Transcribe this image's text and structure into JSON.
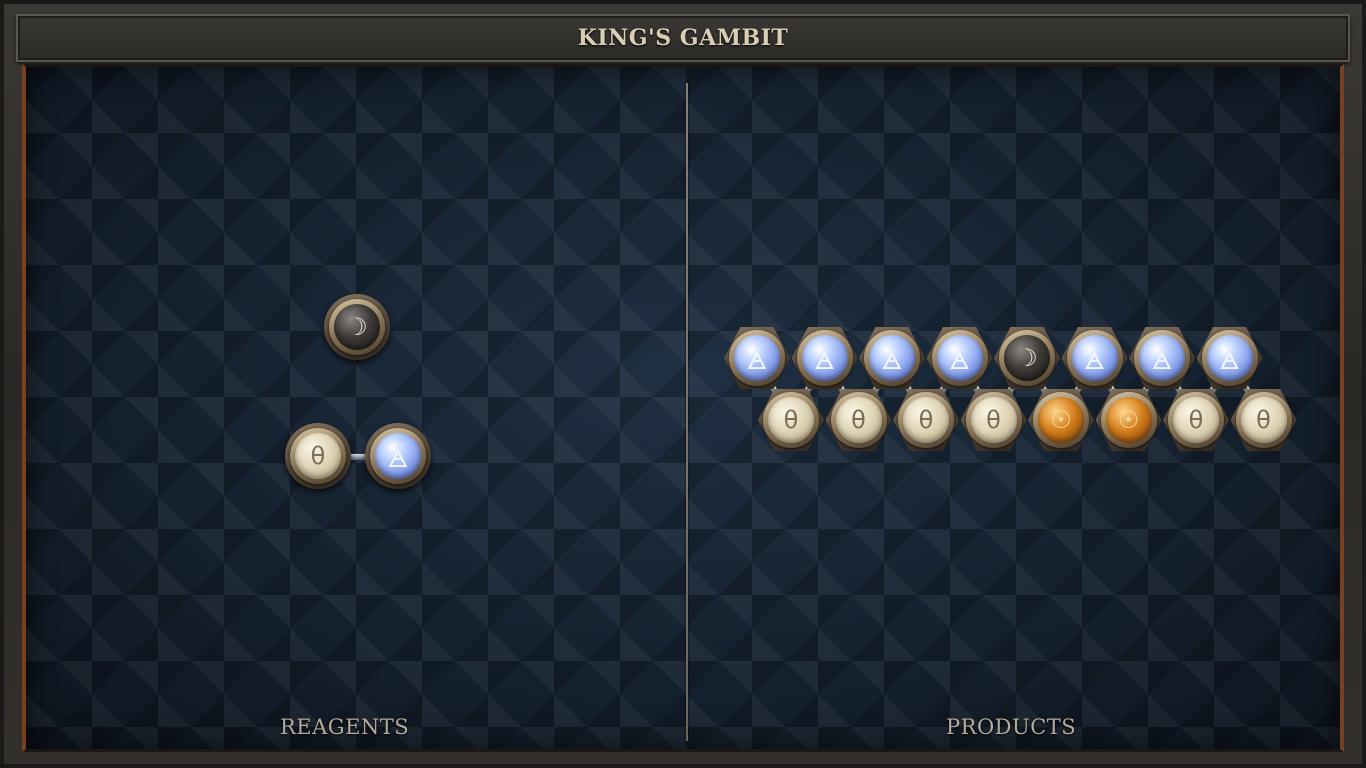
{
  "title": "KING'S GAMBIT",
  "panels": {
    "reagents_label": "REAGENTS",
    "products_label": "PRODUCTS"
  },
  "glyphs": {
    "salt": "θ",
    "air": "🜁",
    "silver": "☽",
    "gold": "☉"
  },
  "colors": {
    "board": "#182434",
    "title_text": "#d9cdb4",
    "label_text": "#b5ab9c",
    "accent_copper": "#7a3f1d"
  },
  "reagents": {
    "molecules": [
      {
        "atoms": [
          "silver"
        ],
        "bonds": []
      },
      {
        "atoms": [
          "salt",
          "air"
        ],
        "bonds": [
          [
            0,
            1
          ]
        ]
      }
    ]
  },
  "products": {
    "molecules": [
      {
        "top_row": [
          "air",
          "air",
          "air",
          "air",
          "silver",
          "air",
          "air",
          "air"
        ],
        "bottom_row": [
          "salt",
          "salt",
          "salt",
          "salt",
          "gold",
          "gold",
          "salt",
          "salt"
        ]
      }
    ]
  }
}
